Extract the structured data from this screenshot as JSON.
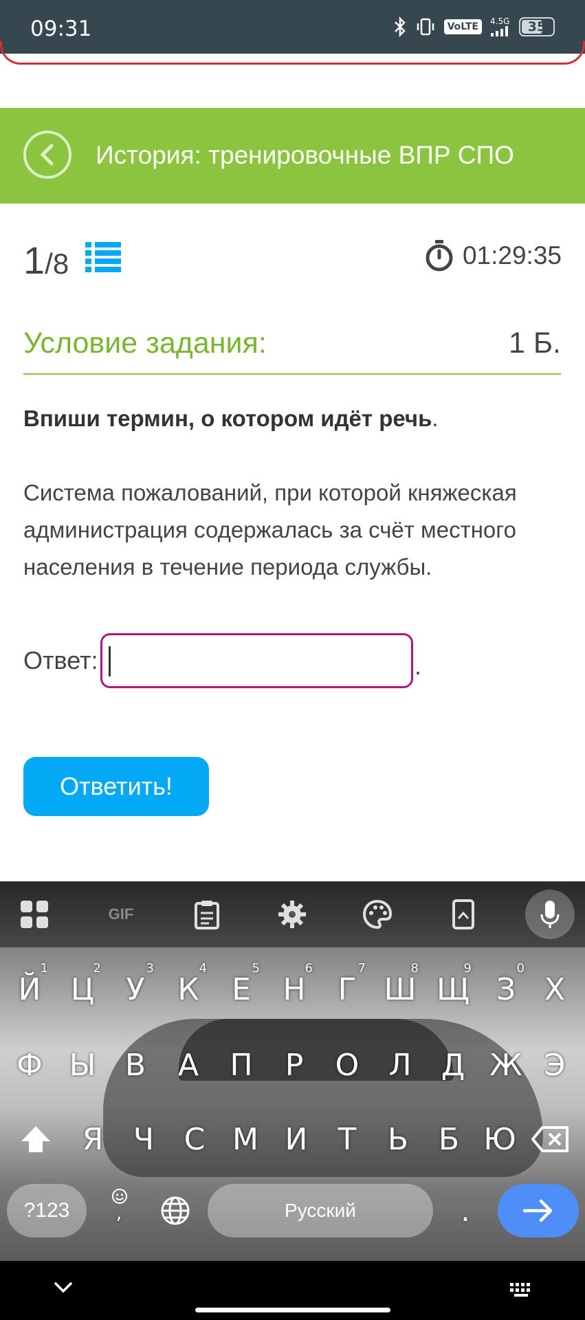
{
  "status_bar": {
    "time": "09:31",
    "volte": "VoLTE",
    "network": "4.5G",
    "battery": "35"
  },
  "header": {
    "title": "История: тренировочные ВПР СПО"
  },
  "progress": {
    "current": "1",
    "total": "/8"
  },
  "timer": {
    "value": "01:29:35"
  },
  "condition": {
    "label": "Условие задания:",
    "score": "1 Б."
  },
  "task": {
    "title": "Впиши термин, о котором идёт речь",
    "title_suffix": ".",
    "text": "Система пожалований, при которой княжеская администрация содержалась за счёт местного населения в течение периода службы."
  },
  "answer": {
    "label": "Ответ:",
    "value": "",
    "suffix": "."
  },
  "submit_label": "Ответить!",
  "keyboard": {
    "toolbar": [
      "apps-icon",
      "gif-icon",
      "clipboard-icon",
      "settings-icon",
      "palette-icon",
      "screenshot-icon",
      "mic-icon"
    ],
    "gif": "GIF",
    "row1": [
      {
        "k": "Й",
        "n": "1"
      },
      {
        "k": "Ц",
        "n": "2"
      },
      {
        "k": "У",
        "n": "3"
      },
      {
        "k": "К",
        "n": "4"
      },
      {
        "k": "Е",
        "n": "5"
      },
      {
        "k": "Н",
        "n": "6"
      },
      {
        "k": "Г",
        "n": "7"
      },
      {
        "k": "Ш",
        "n": "8"
      },
      {
        "k": "Щ",
        "n": "9"
      },
      {
        "k": "З",
        "n": "0"
      },
      {
        "k": "Х",
        "n": ""
      }
    ],
    "row2": [
      "Ф",
      "Ы",
      "В",
      "А",
      "П",
      "Р",
      "О",
      "Л",
      "Д",
      "Ж",
      "Э"
    ],
    "row3": [
      "Я",
      "Ч",
      "С",
      "М",
      "И",
      "Т",
      "Ь",
      "Б",
      "Ю"
    ],
    "symbols": "?123",
    "emoji_comma": ",",
    "space": "Русский",
    "period": "."
  }
}
